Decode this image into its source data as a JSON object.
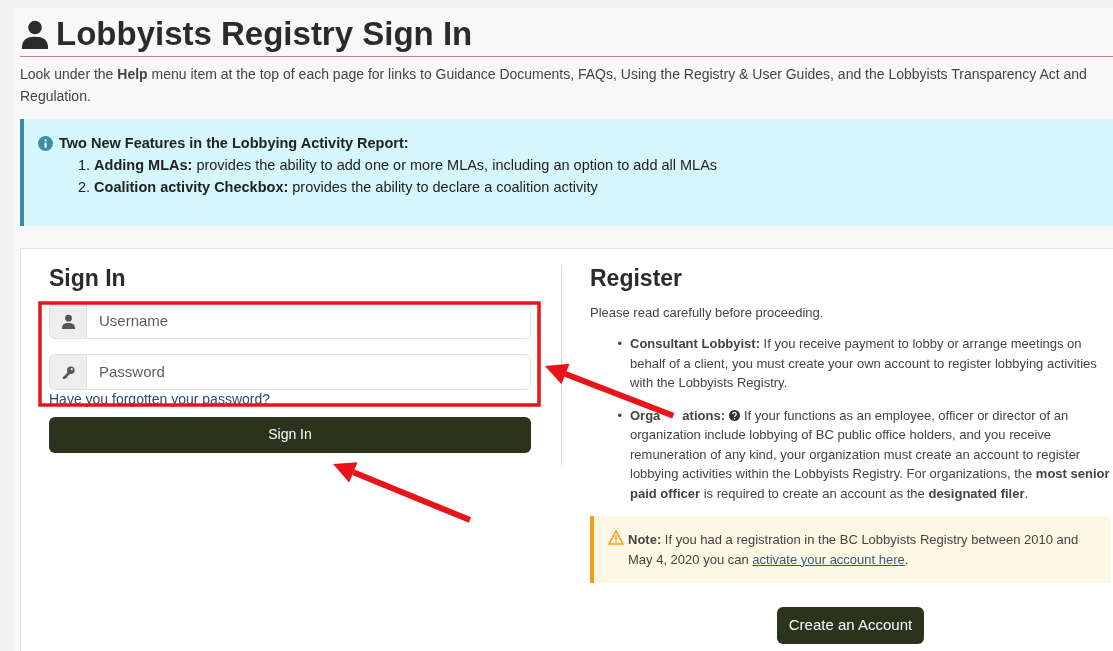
{
  "page_title": "Lobbyists Registry Sign In",
  "intro": "Look under the **Help** menu item at the top of each page for links to Guidance Documents, FAQs, Using the Registry & User Guides, and the Lobbyists Transparency Act and Regulation.",
  "info_alert": {
    "heading": "Two New Features in the Lobbying Activity Report:",
    "items": [
      {
        "number": "1.",
        "text": "**Adding MLAs:** provides the ability to add one or more MLAs, including an option to add all MLAs"
      },
      {
        "number": "2.",
        "text": "**Coalition activity Checkbox:** provides the ability to declare a coalition activity"
      }
    ]
  },
  "sign_in": {
    "heading": "Sign In",
    "fields": [
      {
        "kind": "user",
        "placeholder": "Username"
      },
      {
        "kind": "key",
        "placeholder": "Password"
      }
    ],
    "forgot_link": "Have you forgotten your password?",
    "button": "Sign In"
  },
  "register": {
    "heading": "Register",
    "lead": "Please read carefully before proceeding.",
    "items": [
      {
        "kind": "plain",
        "bullet": "•",
        "text": "**Consultant Lobbyist:** If you receive payment to lobby or arrange meetings on behalf of a client, you must create your own account to register lobbying activities with the Lobbyists Registry."
      },
      {
        "kind": "help",
        "bullet": "•",
        "label_parts": [
          "Orga",
          "ations:"
        ],
        "lead_in": "If your functions as an employee, officer or director of an",
        "rest": "organization include lobbying of BC public office holders, and you receive remuneration of any kind, your organization must create an account to register lobbying activities within the Lobbyists Registry. For organizations, the **most senior paid officer** is required to create an account as the **designated filer**."
      }
    ],
    "note": {
      "label": "Note:",
      "text": "If you had a registration in the BC Lobbyists Registry between 2010 and May 4, 2020 you can",
      "link": "activate your account here",
      "end": "."
    },
    "button": "Create an Account"
  },
  "annotations": [
    {
      "kind": "frame"
    },
    {
      "kind": "arrow"
    },
    {
      "kind": "arrow"
    }
  ]
}
